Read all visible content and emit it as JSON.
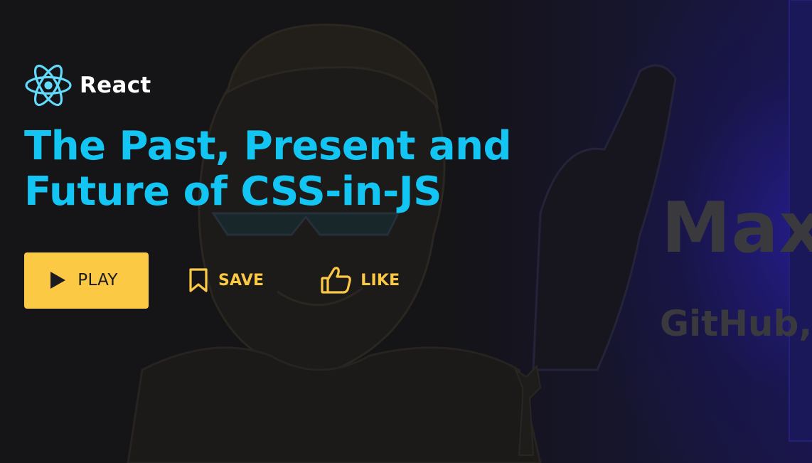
{
  "brand": {
    "icon": "react-logo-icon",
    "name": "React"
  },
  "title": "The Past, Present and Future of CSS-in-JS",
  "actions": {
    "play": {
      "label": "PLAY",
      "icon": "play-icon"
    },
    "save": {
      "label": "SAVE",
      "icon": "bookmark-icon"
    },
    "like": {
      "label": "LIKE",
      "icon": "thumbs-up-icon"
    }
  },
  "backdrop": {
    "name_text": "Max",
    "sub_text": "GitHub,"
  },
  "colors": {
    "background": "#151417",
    "title": "#13c5f2",
    "accent": "#fcc944",
    "brand_text": "#ffffff",
    "react_logo": "#61dafb"
  }
}
